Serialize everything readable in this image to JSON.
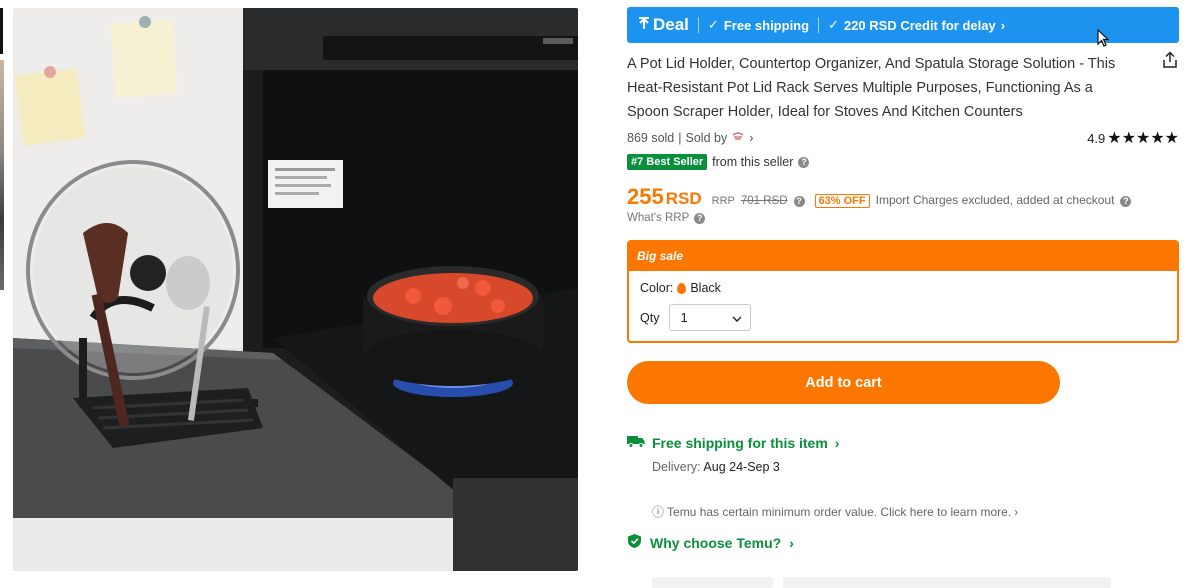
{
  "product_image": {
    "alt_icon": "product-photo-pot-lid-holder"
  },
  "deal_bar": {
    "deal_label": "Deal",
    "free_shipping": "Free shipping",
    "credit": "220 RSD Credit for delay",
    "color": "#1b93ef"
  },
  "title": "A Pot Lid Holder, Countertop Organizer, And Spatula Storage Solution - This Heat-Resistant Pot Lid Rack Serves Multiple Purposes, Functioning As a Spoon Scraper Holder, Ideal for Stoves And Kitchen Counters",
  "meta": {
    "sold": "869 sold",
    "sold_by": "Sold by",
    "rating": "4.9",
    "stars": "★★★★★"
  },
  "seller": {
    "badge": "#7 Best Seller",
    "text": "from this seller"
  },
  "price": {
    "amount": "255",
    "currency": "RSD",
    "rrp_label": "RRP",
    "rrp_value": "701 RSD",
    "discount": "63% OFF",
    "import_note": "Import Charges excluded, added at checkout",
    "whats_rrp": "What's RRP",
    "accent": "#fb7701"
  },
  "sale": {
    "header": "Big sale",
    "color_label": "Color:",
    "color_value": "Black",
    "qty_label": "Qty",
    "qty_value": "1"
  },
  "add_to_cart": "Add to cart",
  "shipping": {
    "label": "Free shipping for this item",
    "delivery_label": "Delivery:",
    "delivery_dates": "Aug 24-Sep 3"
  },
  "min_order": "Temu has certain minimum order value. Click here to learn more.",
  "why_choose": "Why choose Temu?"
}
